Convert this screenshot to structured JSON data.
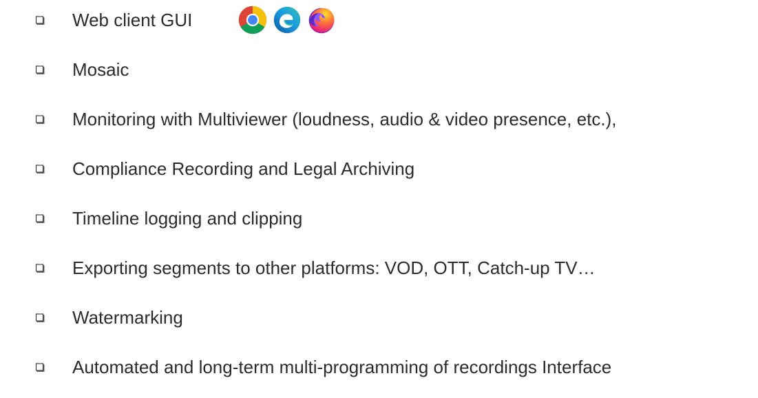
{
  "features": [
    {
      "label": "Web client GUI",
      "has_browsers": true
    },
    {
      "label": "Mosaic"
    },
    {
      "label": "Monitoring with Multiviewer (loudness, audio & video presence, etc.),"
    },
    {
      "label": "Compliance Recording and Legal Archiving"
    },
    {
      "label": "Timeline logging and clipping"
    },
    {
      "label": "Exporting segments to other platforms: VOD, OTT, Catch-up TV…"
    },
    {
      "label": "Watermarking"
    },
    {
      "label": "Automated and long-term multi-programming of recordings Interface"
    }
  ],
  "browsers": [
    {
      "icon": "chrome-icon"
    },
    {
      "icon": "edge-icon"
    },
    {
      "icon": "firefox-icon"
    }
  ],
  "colors": {
    "text": "#2b2b2b",
    "chrome_red": "#db4437",
    "chrome_yellow": "#f4c20d",
    "chrome_green": "#0f9d58",
    "chrome_blue": "#4285f4",
    "edge_blue": "#0c59a4",
    "edge_teal": "#35c1a8",
    "firefox_orange": "#ff7139",
    "firefox_purple": "#592acb"
  }
}
